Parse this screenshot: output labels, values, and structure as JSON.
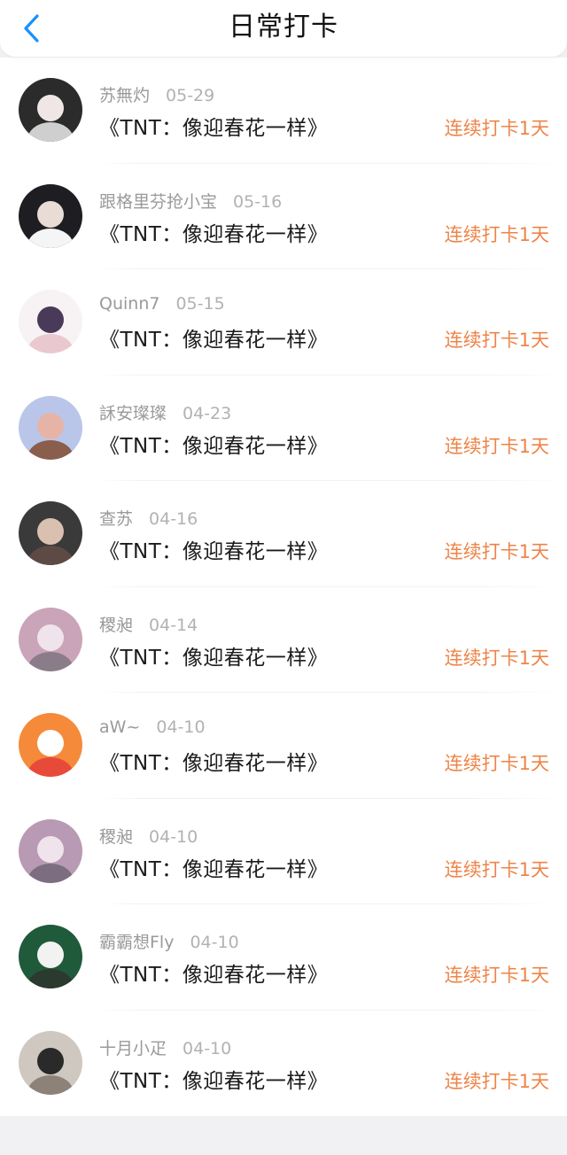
{
  "header": {
    "title": "日常打卡",
    "back_icon": "chevron-left-icon",
    "accent": "#1890ff"
  },
  "colors": {
    "streak": "#ee8448",
    "name": "#9a9a9a"
  },
  "records": [
    {
      "name": "苏無灼",
      "date": "05-29",
      "course": "《TNT：像迎春花一样》",
      "streak": "连续打卡1天",
      "avatar_colors": [
        "#2b2b2b",
        "#f0e6e6",
        "#cfcfcf"
      ]
    },
    {
      "name": "跟格里芬抢小宝",
      "date": "05-16",
      "course": "《TNT：像迎春花一样》",
      "streak": "连续打卡1天",
      "avatar_colors": [
        "#1e1e22",
        "#e8dcd4",
        "#f5f5f5"
      ]
    },
    {
      "name": "Quinn7",
      "date": "05-15",
      "course": "《TNT：像迎春花一样》",
      "streak": "连续打卡1天",
      "avatar_colors": [
        "#f7f3f5",
        "#4a3a5a",
        "#e9c9cf"
      ]
    },
    {
      "name": "訸安璨璨",
      "date": "04-23",
      "course": "《TNT：像迎春花一样》",
      "streak": "连续打卡1天",
      "avatar_colors": [
        "#b9c6ea",
        "#e6b4a6",
        "#8a5e4c"
      ]
    },
    {
      "name": "查苏",
      "date": "04-16",
      "course": "《TNT：像迎春花一样》",
      "streak": "连续打卡1天",
      "avatar_colors": [
        "#3a3a3a",
        "#d9c0b0",
        "#5e4a44"
      ]
    },
    {
      "name": "稷昶",
      "date": "04-14",
      "course": "《TNT：像迎春花一样》",
      "streak": "连续打卡1天",
      "avatar_colors": [
        "#caa4b8",
        "#efe4ec",
        "#8a7c88"
      ]
    },
    {
      "name": "aW~",
      "date": "04-10",
      "course": "《TNT：像迎春花一样》",
      "streak": "连续打卡1天",
      "avatar_colors": [
        "#f58a3a",
        "#ffffff",
        "#e84a3a"
      ]
    },
    {
      "name": "稷昶",
      "date": "04-10",
      "course": "《TNT：像迎春花一样》",
      "streak": "连续打卡1天",
      "avatar_colors": [
        "#b89ab4",
        "#efe4ec",
        "#7c6e80"
      ]
    },
    {
      "name": "霸霸想Fly",
      "date": "04-10",
      "course": "《TNT：像迎春花一样》",
      "streak": "连续打卡1天",
      "avatar_colors": [
        "#1f5a3a",
        "#f2f2f2",
        "#2a3a2e"
      ]
    },
    {
      "name": "十月小疋",
      "date": "04-10",
      "course": "《TNT：像迎春花一样》",
      "streak": "连续打卡1天",
      "avatar_colors": [
        "#cfc8c0",
        "#2a2a2a",
        "#8c8278"
      ]
    }
  ]
}
